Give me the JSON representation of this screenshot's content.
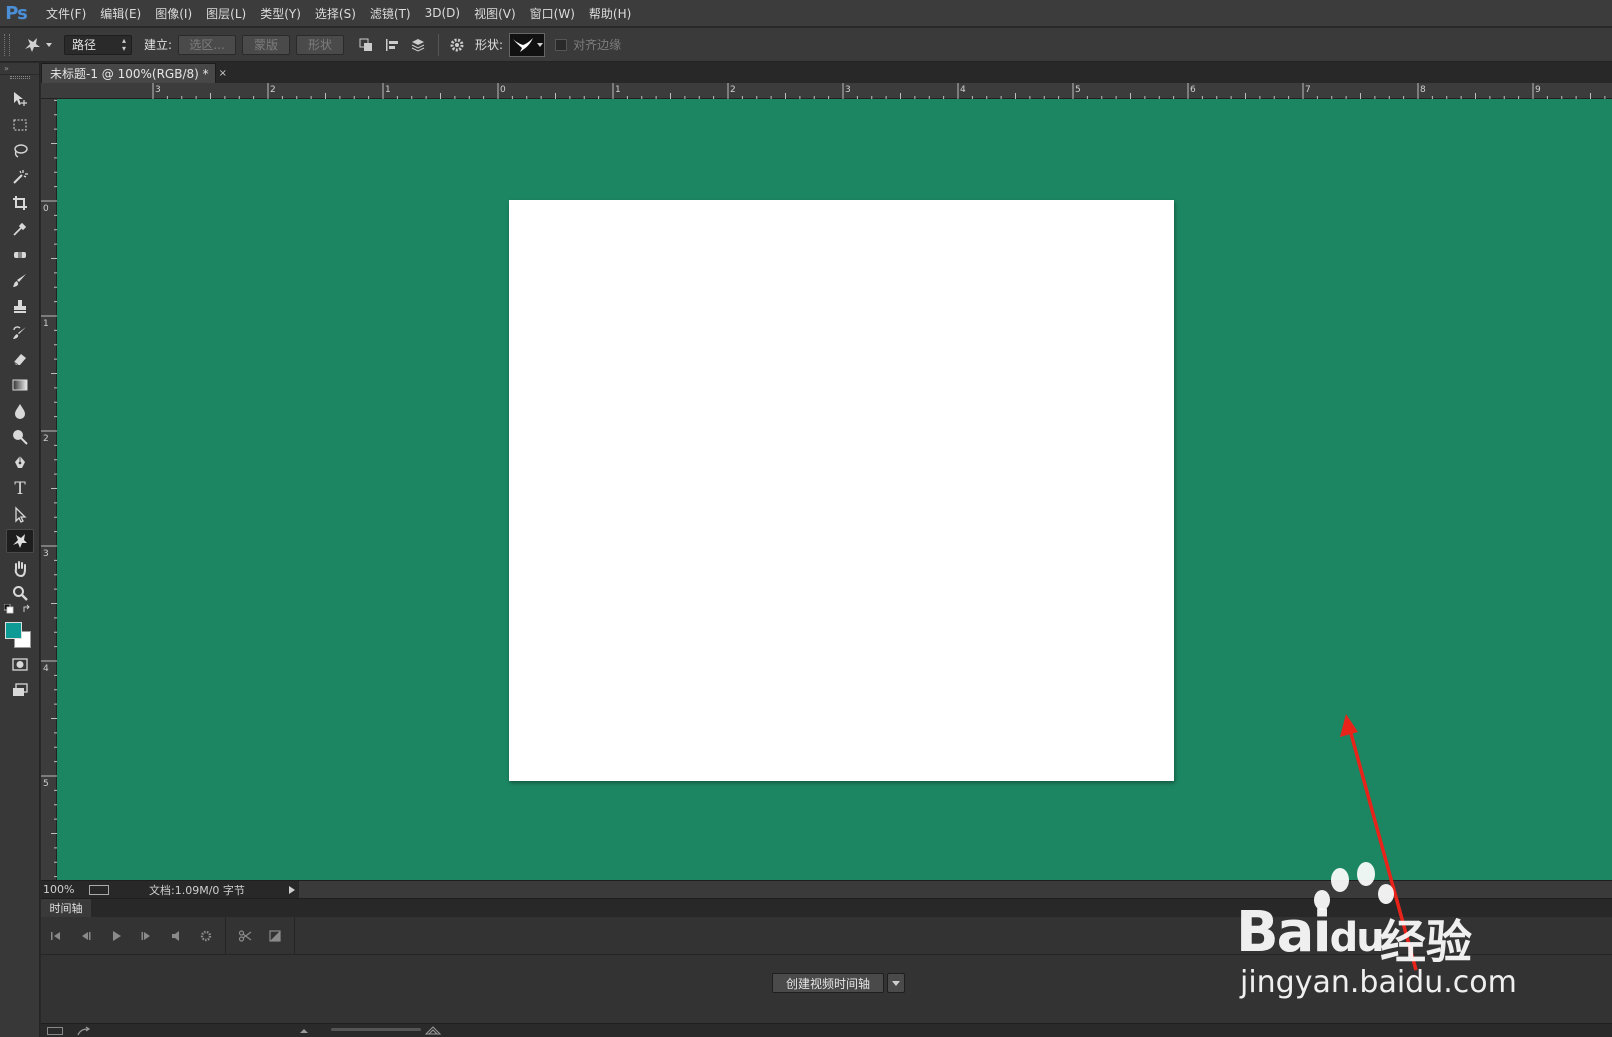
{
  "app": {
    "logo": "Ps"
  },
  "menu": [
    {
      "label": "文件(F)",
      "name": "menu-file"
    },
    {
      "label": "编辑(E)",
      "name": "menu-edit"
    },
    {
      "label": "图像(I)",
      "name": "menu-image"
    },
    {
      "label": "图层(L)",
      "name": "menu-layer"
    },
    {
      "label": "类型(Y)",
      "name": "menu-type"
    },
    {
      "label": "选择(S)",
      "name": "menu-select"
    },
    {
      "label": "滤镜(T)",
      "name": "menu-filter"
    },
    {
      "label": "3D(D)",
      "name": "menu-3d"
    },
    {
      "label": "视图(V)",
      "name": "menu-view"
    },
    {
      "label": "窗口(W)",
      "name": "menu-window"
    },
    {
      "label": "帮助(H)",
      "name": "menu-help"
    }
  ],
  "options": {
    "mode_value": "路径",
    "make_label": "建立:",
    "selection_btn": "选区...",
    "mask_btn": "蒙版",
    "shape_btn": "形状",
    "shape_label": "形状:",
    "align_edges_label": "对齐边缘"
  },
  "document": {
    "tab_title": "未标题-1 @ 100%(RGB/8) *",
    "tab_close": "×",
    "pasteboard_color": "#1c8663",
    "canvas_color": "#ffffff"
  },
  "rulers": {
    "top": [
      "3",
      "2",
      "1",
      "0",
      "1",
      "2",
      "3",
      "4",
      "5",
      "6",
      "7",
      "8",
      "9"
    ],
    "left": [
      "0",
      "1",
      "2",
      "3",
      "4",
      "5"
    ]
  },
  "toolbar": {
    "tools": [
      {
        "name": "move-tool",
        "icon": "move-icon"
      },
      {
        "name": "marquee-tool",
        "icon": "marquee-icon"
      },
      {
        "name": "lasso-tool",
        "icon": "lasso-icon"
      },
      {
        "name": "magic-wand-tool",
        "icon": "magic-wand-icon"
      },
      {
        "name": "crop-tool",
        "icon": "crop-icon"
      },
      {
        "name": "eyedropper-tool",
        "icon": "eyedropper-icon"
      },
      {
        "name": "healing-tool",
        "icon": "bandage-icon"
      },
      {
        "name": "brush-tool",
        "icon": "brush-icon"
      },
      {
        "name": "stamp-tool",
        "icon": "stamp-icon"
      },
      {
        "name": "history-brush-tool",
        "icon": "history-brush-icon"
      },
      {
        "name": "eraser-tool",
        "icon": "eraser-icon"
      },
      {
        "name": "gradient-tool",
        "icon": "gradient-icon"
      },
      {
        "name": "blur-tool",
        "icon": "drop-icon"
      },
      {
        "name": "dodge-tool",
        "icon": "dodge-icon"
      },
      {
        "name": "pen-tool",
        "icon": "pen-icon"
      },
      {
        "name": "type-tool",
        "icon": "type-icon"
      },
      {
        "name": "path-selection-tool",
        "icon": "arrow-icon"
      },
      {
        "name": "custom-shape-tool",
        "icon": "shape-icon"
      },
      {
        "name": "hand-tool",
        "icon": "hand-icon"
      },
      {
        "name": "zoom-tool",
        "icon": "zoom-icon"
      }
    ],
    "type_glyph": "T",
    "foreground_color": "#0e9a95",
    "background_color": "#ffffff"
  },
  "status": {
    "zoom": "100%",
    "doc_info": "文档:1.09M/0 字节"
  },
  "timeline": {
    "tab_label": "时间轴",
    "create_btn": "创建视频时间轴"
  },
  "watermark": {
    "brand": "Bai",
    "brand_tail": "du",
    "cn": "经验",
    "url": "jingyan.baidu.com"
  },
  "annotation": {
    "arrow_color": "#e8231a"
  }
}
